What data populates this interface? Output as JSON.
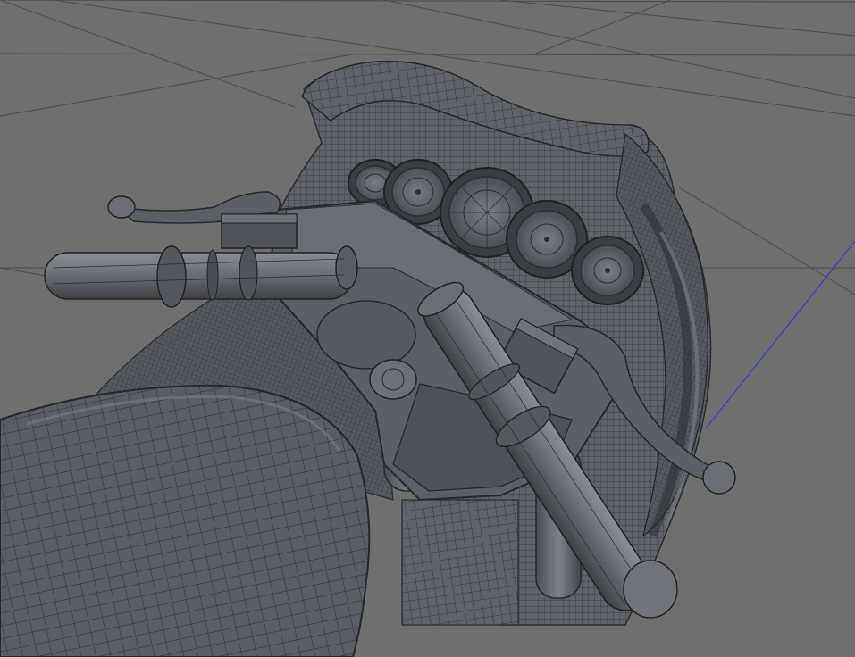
{
  "viewport": {
    "background_color": "#6f6f6f",
    "grid_color": "#4a4a4a",
    "axis_color": "#3b3bd6",
    "mesh_fill": "#5d6066",
    "mesh_dark": "#464a50",
    "wire_color": "#2f3236",
    "highlight": "#8e939a",
    "object": "motorcycle-handlebar-cockpit-wireframe"
  }
}
